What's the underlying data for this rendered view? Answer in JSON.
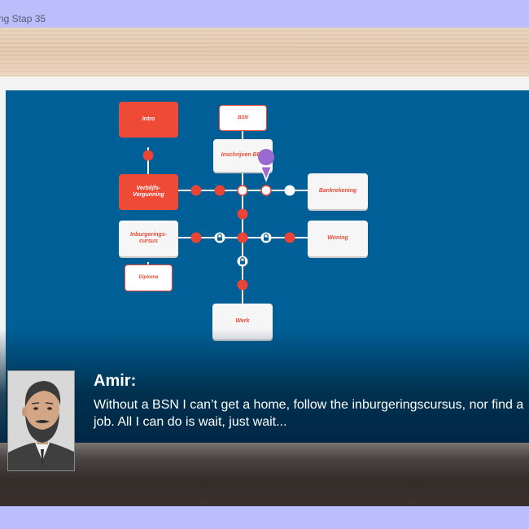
{
  "window": {
    "title": "ng Stap 35"
  },
  "map": {
    "nodes": {
      "intro": "Intro",
      "bsn": "BSN",
      "inschrijven": "Inschrijven BRP",
      "verblijfs": "Verblijfs-\nVergunning",
      "bankrekening": "Bankrekening",
      "inburgering": "Inburgerings-\ncursus",
      "woning": "Woning",
      "diploma": "Diploma",
      "werk": "Werk"
    },
    "player_marker": "player-pin-icon",
    "locked_icon": "padlock-icon"
  },
  "dialogue": {
    "speaker": "Amir:",
    "text": "Without a BSN I can’t get a home, follow the inburgeringscursus, nor find a job. All I can do is wait, just wait..."
  },
  "colors": {
    "map_bg": "#005f96",
    "node_red": "#ee4a35",
    "path_white": "#ffffff",
    "dot_red": "#e94536",
    "player": "#9b6ad0",
    "outer_bg": "#bcbdfb"
  }
}
